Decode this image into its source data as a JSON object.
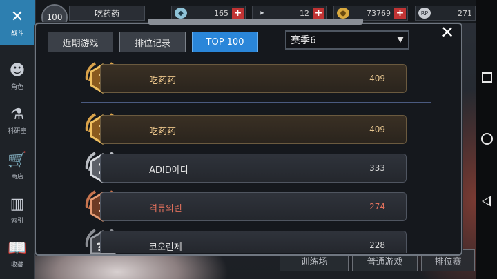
{
  "sidebar": {
    "items": [
      {
        "label": "战斗",
        "icon": "crossed-guns-icon",
        "active": true
      },
      {
        "label": "角色",
        "icon": "character-icon",
        "active": false
      },
      {
        "label": "科研室",
        "icon": "flask-icon",
        "active": false
      },
      {
        "label": "商店",
        "icon": "cart-icon",
        "active": false
      },
      {
        "label": "索引",
        "icon": "books-icon",
        "active": false
      },
      {
        "label": "收藏",
        "icon": "book-open-icon",
        "active": false
      }
    ]
  },
  "topbar": {
    "level": "100",
    "player_name": "吃药药",
    "resources": [
      {
        "icon": "diamond-icon",
        "value": "165"
      },
      {
        "icon": "bullet-icon",
        "value": "12"
      },
      {
        "icon": "coin-icon",
        "value": "73769"
      },
      {
        "icon": "rp-icon",
        "value": "271"
      }
    ]
  },
  "modal": {
    "tabs": [
      {
        "label": "近期游戏",
        "active": false
      },
      {
        "label": "排位记录",
        "active": false
      },
      {
        "label": "TOP 100",
        "active": true
      }
    ],
    "season_select": {
      "value": "赛季6"
    },
    "my_rank": {
      "rank": "1",
      "name": "吃药药",
      "score": "409",
      "tier": "gold"
    },
    "rankings": [
      {
        "rank": "1",
        "name": "吃药药",
        "score": "409",
        "tier": "gold"
      },
      {
        "rank": "2",
        "name": "ADID아디",
        "score": "333",
        "tier": "silver"
      },
      {
        "rank": "3",
        "name": "격류의린",
        "score": "274",
        "tier": "bronze"
      },
      {
        "rank": "??",
        "name": "코오린제",
        "score": "228",
        "tier": "unranked"
      }
    ]
  },
  "bottom_buttons": [
    {
      "label": "训练场"
    },
    {
      "label": "普通游戏"
    },
    {
      "label": "排位赛"
    }
  ],
  "colors": {
    "accent": "#2a86d9",
    "gold": "#d9a24a",
    "silver": "#b9bcc2",
    "bronze": "#c8744e"
  }
}
